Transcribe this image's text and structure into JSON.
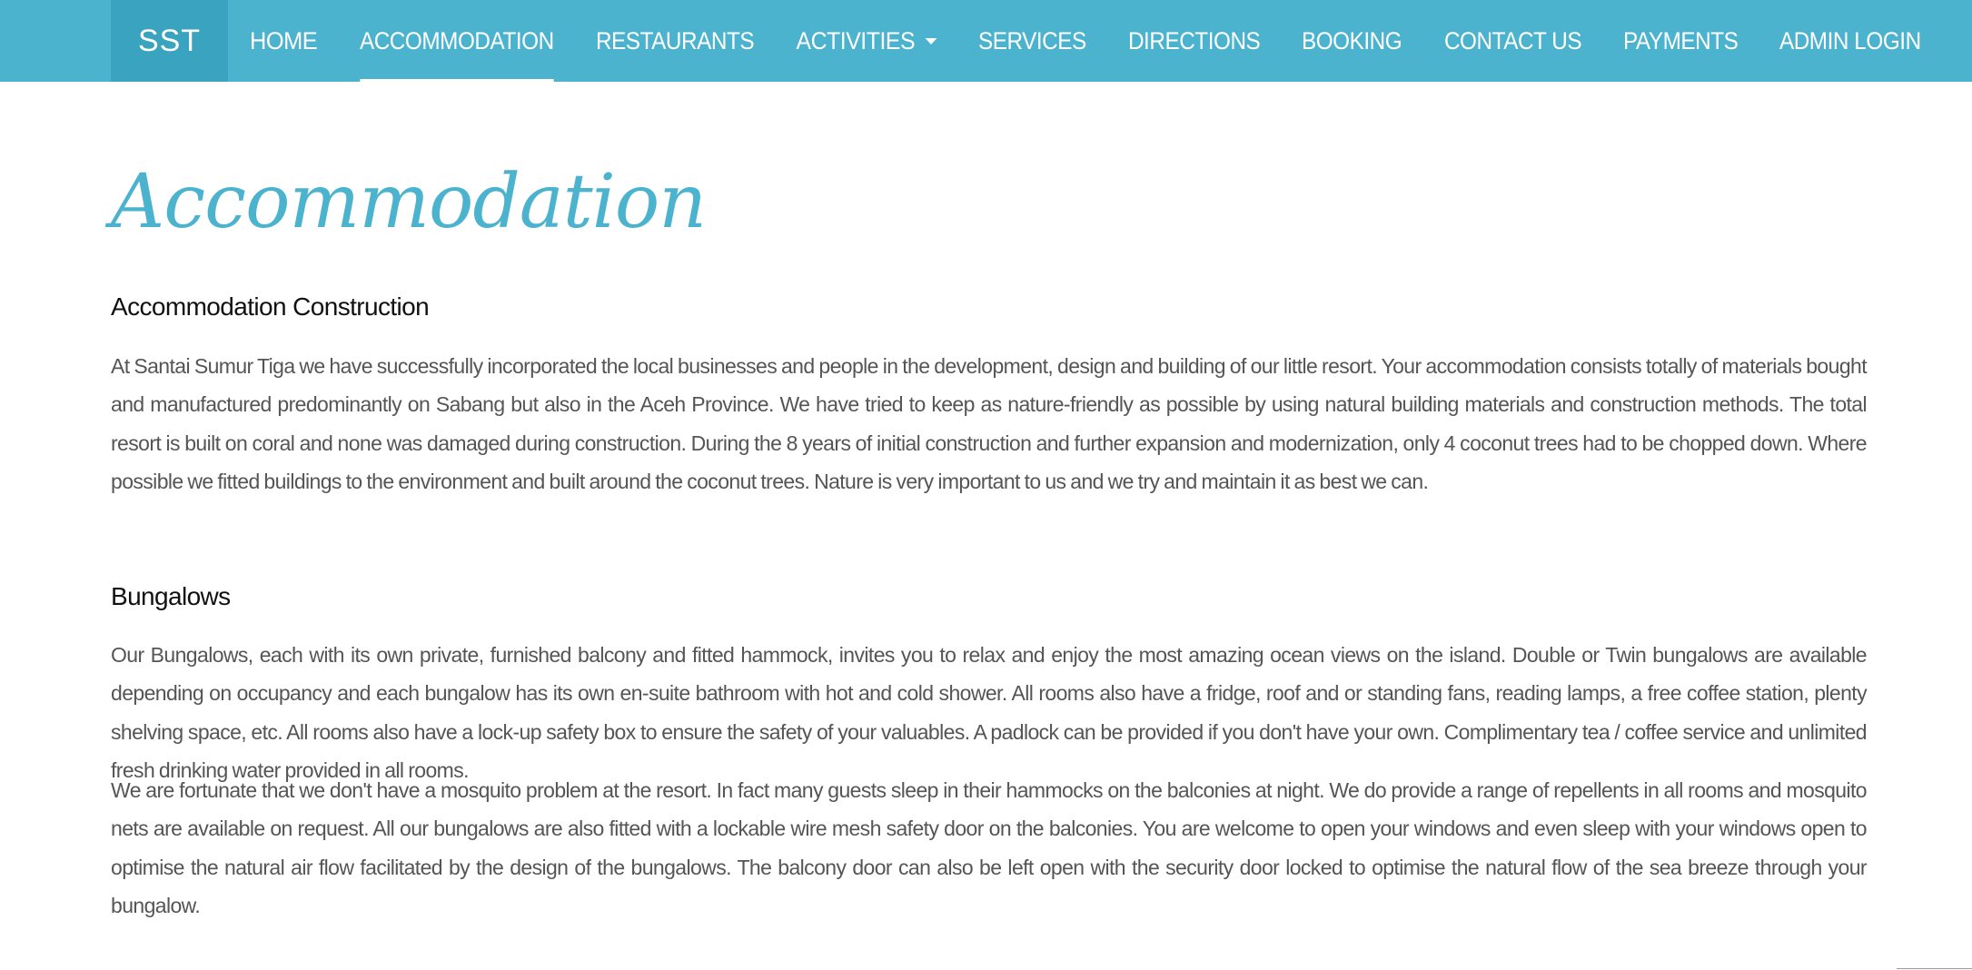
{
  "nav": {
    "brand": "SST",
    "items": [
      {
        "label": "HOME"
      },
      {
        "label": "ACCOMMODATION",
        "active": true
      },
      {
        "label": "RESTAURANTS"
      },
      {
        "label": "ACTIVITIES",
        "dropdown": true
      },
      {
        "label": "SERVICES"
      },
      {
        "label": "DIRECTIONS"
      },
      {
        "label": "BOOKING"
      },
      {
        "label": "CONTACT US"
      },
      {
        "label": "PAYMENTS"
      },
      {
        "label": "ADMIN LOGIN"
      }
    ]
  },
  "page": {
    "title": "Accommodation"
  },
  "sections": {
    "construction": {
      "heading": "Accommodation Construction",
      "paragraphs": [
        "At Santai Sumur Tiga we have successfully incorporated the local businesses and people in the development, design and building of our little resort. Your accommodation consists totally of materials bought and manufactured predominantly on Sabang but also in the Aceh Province. We have tried to keep as nature-friendly as possible by using natural building materials and construction methods. The total resort is built on coral and none was damaged during construction. During the 8 years of initial construction and further expansion and modernization, only 4 coconut trees had to be chopped down. Where possible we fitted buildings to the environment and built around the coconut trees. Nature is very important to us and we try and maintain it as best we can."
      ]
    },
    "bungalows": {
      "heading": "Bungalows",
      "paragraphs": [
        "Our Bungalows, each with its own private, furnished balcony and fitted hammock, invites you to relax and enjoy the most amazing ocean views on the island. Double or Twin bungalows are available depending on occupancy and each bungalow has its own en-suite bathroom with hot and cold shower. All rooms also have a fridge, roof and or standing fans, reading lamps, a free coffee station, plenty shelving space, etc. All rooms also have a lock-up safety box to ensure the safety of your valuables. A padlock can be provided if you don't have your own. Complimentary tea / coffee service and unlimited fresh drinking water provided in all rooms.",
        "We are fortunate that we don't have a mosquito problem at the resort. In fact many guests sleep in their hammocks on the balconies at night. We do provide a range of repellents in all rooms and mosquito nets are available on request. All our bungalows are also fitted with a lockable wire mesh safety door on the balconies. You are welcome to open your windows and even sleep with your windows open to optimise the natural air flow facilitated by the design of the bungalows. The balcony door can also be left open with the security door locked to optimise the natural flow of the sea breeze through your bungalow."
      ]
    }
  },
  "colors": {
    "accent": "#4cb3cf",
    "brand_bg": "#3aa3c0",
    "body_text": "#555555",
    "heading_text": "#111111"
  }
}
